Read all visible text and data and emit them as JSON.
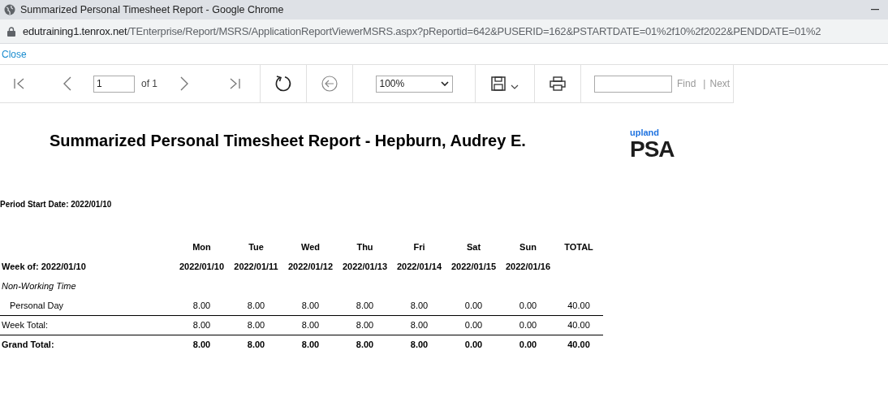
{
  "window": {
    "title": "Summarized Personal Timesheet Report - Google Chrome"
  },
  "address_bar": {
    "host": "edutraining1.tenrox.net",
    "path": "/TEnterprise/Report/MSRS/ApplicationReportViewerMSRS.aspx?pReportid=642&PUSERID=162&PSTARTDATE=01%2f10%2f2022&PENDDATE=01%2"
  },
  "close_link": "Close",
  "toolbar": {
    "page": "1",
    "page_count": "of 1",
    "zoom": "100%",
    "find": "Find",
    "separator": "|",
    "next": "Next"
  },
  "report": {
    "title": "Summarized Personal Timesheet Report - Hepburn, Audrey E.",
    "logo_small": "upland",
    "logo_large": "PSA",
    "period": "Period Start Date: 2022/01/10",
    "columns": [
      "Mon",
      "Tue",
      "Wed",
      "Thu",
      "Fri",
      "Sat",
      "Sun",
      "TOTAL"
    ],
    "week_label": "Week of: 2022/01/10",
    "dates": [
      "2022/01/10",
      "2022/01/11",
      "2022/01/12",
      "2022/01/13",
      "2022/01/14",
      "2022/01/15",
      "2022/01/16"
    ],
    "rows": [
      {
        "kind": "group",
        "label": "Non-Working Time"
      },
      {
        "kind": "item",
        "label": "Personal Day",
        "values": [
          "8.00",
          "8.00",
          "8.00",
          "8.00",
          "8.00",
          "0.00",
          "0.00",
          "40.00"
        ]
      },
      {
        "kind": "subtotal",
        "label": "Week Total:",
        "values": [
          "8.00",
          "8.00",
          "8.00",
          "8.00",
          "8.00",
          "0.00",
          "0.00",
          "40.00"
        ]
      },
      {
        "kind": "total",
        "label": "Grand Total:",
        "values": [
          "8.00",
          "8.00",
          "8.00",
          "8.00",
          "8.00",
          "0.00",
          "0.00",
          "40.00"
        ]
      }
    ]
  }
}
